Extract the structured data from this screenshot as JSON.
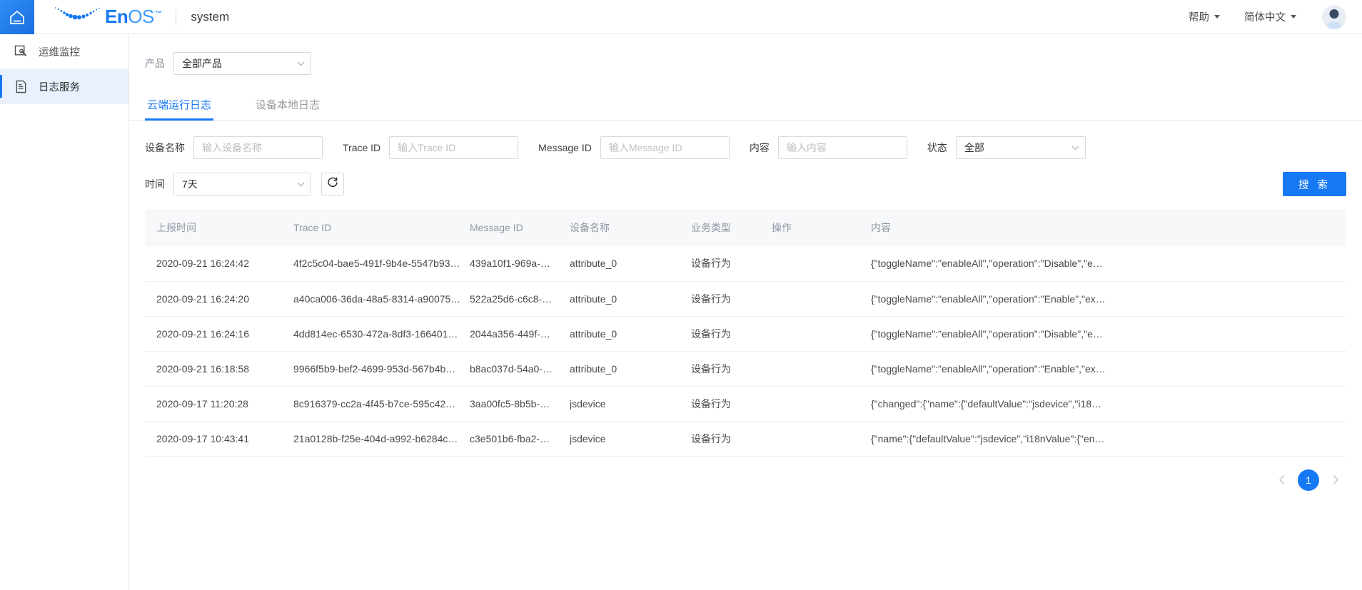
{
  "topbar": {
    "home_icon": "home-icon",
    "brand_en": "En",
    "brand_os": "OS",
    "brand_tm": "™",
    "app_name": "system",
    "help_label": "帮助",
    "lang_label": "简体中文",
    "avatar_icon": "user-avatar-icon"
  },
  "sidebar": {
    "items": [
      {
        "label": "运维监控",
        "icon": "monitor-wrench-icon",
        "active": false
      },
      {
        "label": "日志服务",
        "icon": "document-lines-icon",
        "active": true
      }
    ]
  },
  "product_filter": {
    "label": "产品",
    "value": "全部产品",
    "chevron_icon": "chevron-down-icon"
  },
  "tabs": [
    {
      "label": "云端运行日志",
      "active": true
    },
    {
      "label": "设备本地日志",
      "active": false
    }
  ],
  "filters": {
    "device_name": {
      "label": "设备名称",
      "placeholder": "输入设备名称",
      "value": ""
    },
    "trace_id": {
      "label": "Trace ID",
      "placeholder": "输入Trace ID",
      "value": ""
    },
    "message_id": {
      "label": "Message ID",
      "placeholder": "输入Message ID",
      "value": ""
    },
    "content": {
      "label": "内容",
      "placeholder": "输入内容",
      "value": ""
    },
    "status": {
      "label": "状态",
      "value": "全部",
      "chevron_icon": "chevron-down-icon"
    },
    "time": {
      "label": "时间",
      "value": "7天",
      "chevron_icon": "chevron-down-icon"
    },
    "refresh_icon": "refresh-icon",
    "search_button": "搜 索"
  },
  "table": {
    "columns": [
      "上报时间",
      "Trace ID",
      "Message ID",
      "设备名称",
      "业务类型",
      "操作",
      "内容"
    ],
    "rows": [
      {
        "time": "2020-09-21 16:24:42",
        "trace_id": "4f2c5c04-bae5-491f-9b4e-5547b93…",
        "message_id": "439a10f1-969a-…",
        "device_name": "attribute_0",
        "biz_type": "设备行为",
        "operation": "",
        "content": "{\"toggleName\":\"enableAll\",\"operation\":\"Disable\",\"e…"
      },
      {
        "time": "2020-09-21 16:24:20",
        "trace_id": "a40ca006-36da-48a5-8314-a90075…",
        "message_id": "522a25d6-c6c8-…",
        "device_name": "attribute_0",
        "biz_type": "设备行为",
        "operation": "",
        "content": "{\"toggleName\":\"enableAll\",\"operation\":\"Enable\",\"ex…"
      },
      {
        "time": "2020-09-21 16:24:16",
        "trace_id": "4dd814ec-6530-472a-8df3-166401…",
        "message_id": "2044a356-449f-…",
        "device_name": "attribute_0",
        "biz_type": "设备行为",
        "operation": "",
        "content": "{\"toggleName\":\"enableAll\",\"operation\":\"Disable\",\"e…"
      },
      {
        "time": "2020-09-21 16:18:58",
        "trace_id": "9966f5b9-bef2-4699-953d-567b4b…",
        "message_id": "b8ac037d-54a0-…",
        "device_name": "attribute_0",
        "biz_type": "设备行为",
        "operation": "",
        "content": "{\"toggleName\":\"enableAll\",\"operation\":\"Enable\",\"ex…"
      },
      {
        "time": "2020-09-17 11:20:28",
        "trace_id": "8c916379-cc2a-4f45-b7ce-595c42…",
        "message_id": "3aa00fc5-8b5b-…",
        "device_name": "jsdevice",
        "biz_type": "设备行为",
        "operation": "",
        "content": "{\"changed\":{\"name\":{\"defaultValue\":\"jsdevice\",\"i18…"
      },
      {
        "time": "2020-09-17 10:43:41",
        "trace_id": "21a0128b-f25e-404d-a992-b6284c…",
        "message_id": "c3e501b6-fba2-…",
        "device_name": "jsdevice",
        "biz_type": "设备行为",
        "operation": "",
        "content": "{\"name\":{\"defaultValue\":\"jsdevice\",\"i18nValue\":{\"en…"
      }
    ]
  },
  "pagination": {
    "prev_icon": "chevron-left-icon",
    "next_icon": "chevron-right-icon",
    "current_page": "1"
  },
  "colors": {
    "accent": "#1678f3",
    "sidebar_active_bg": "#e8f1fd",
    "table_header_bg": "#f7f8fa"
  }
}
